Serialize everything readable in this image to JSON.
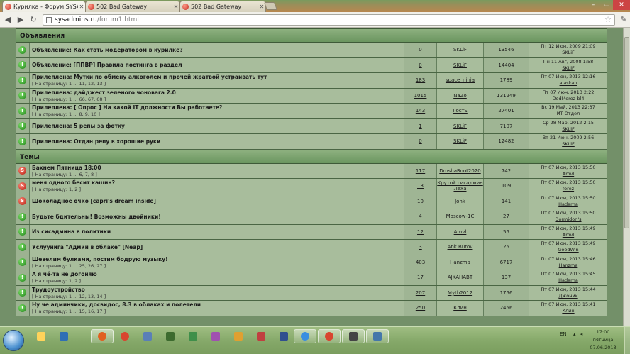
{
  "browser": {
    "tabs": [
      {
        "label": "Курилка - Форум SYSAdmins.RU",
        "active": true
      },
      {
        "label": "502 Bad Gateway",
        "active": false
      },
      {
        "label": "502 Bad Gateway",
        "active": false
      }
    ],
    "url_host": "sysadmins.ru",
    "url_path": "/forum1.html"
  },
  "sections": {
    "announcements_label": "Объявления",
    "topics_label": "Темы"
  },
  "announcements": [
    {
      "icon": "topic-ann-icon",
      "title": "Объявление: Как стать модератором в курилке?",
      "pages": "",
      "replies": "0",
      "author": "SKLiF",
      "views": "13546",
      "last_date": "Пт 12 Июн, 2009 21:09",
      "last_user": "SKLiF"
    },
    {
      "icon": "topic-ann-icon",
      "title": "Объявление: [ППВР] Правила постинга в раздел",
      "pages": "",
      "replies": "0",
      "author": "SKLiF",
      "views": "14404",
      "last_date": "Пн 11 Авг, 2008 1:58",
      "last_user": "SKLiF"
    },
    {
      "icon": "topic-ann-icon",
      "title": "Прилеплена: Мутки по обмену алкоголем и прочей жратвой устраивать тут",
      "pages": "[ На страницу: 1 ... 11, 12, 13 ]",
      "replies": "183",
      "author": "space_ninja",
      "views": "1789",
      "last_date": "Пт 07 Июн, 2013 12:16",
      "last_user": "alaskan"
    },
    {
      "icon": "topic-ann-icon",
      "title": "Прилеплена: дайджест зеленого чоновага 2.0",
      "pages": "[ На страницу: 1 ... 66, 67, 68 ]",
      "replies": "1015",
      "author": "NaZo",
      "views": "131249",
      "last_date": "Пт 07 Июн, 2013 2:22",
      "last_user": "DedMoroz-bl4"
    },
    {
      "icon": "topic-ann-icon",
      "title": "Прилеплена: [ Опрос ] На какой IT должности Вы работаете?",
      "pages": "[ На страницу: 1 ... 8, 9, 10 ]",
      "replies": "143",
      "author": "Гость",
      "views": "27401",
      "last_date": "Вс 19 Май, 2013 22:37",
      "last_user": "ИТ Отдел"
    },
    {
      "icon": "topic-ann-icon",
      "title": "Прилеплена: 5 репы за фотку",
      "pages": "",
      "replies": "1",
      "author": "SKLiF",
      "views": "7107",
      "last_date": "Ср 28 Мар, 2012 2:15",
      "last_user": "SKLiF"
    },
    {
      "icon": "topic-ann-icon",
      "title": "Прилеплена: Отдан репу в хорошие руки",
      "pages": "",
      "replies": "0",
      "author": "SKLiF",
      "views": "12482",
      "last_date": "Вт 21 Июн, 2009 2:56",
      "last_user": "SKLiF"
    }
  ],
  "topics": [
    {
      "icon": "topic-hot-icon",
      "title": "Бахнем Пятница 18:00",
      "pages": "[ На страницу: 1 ... 6, 7, 8 ]",
      "replies": "117",
      "author": "DroshaRoot2020",
      "views": "742",
      "last_date": "Пт 07 Июн, 2013 15:50",
      "last_user": "Amvl"
    },
    {
      "icon": "topic-hot-icon",
      "title": "меня одного бесит кашин?",
      "pages": "[ На страницу: 1, 2 ]",
      "replies": "13",
      "author": "Крутой сисадмин Леха",
      "views": "109",
      "last_date": "Пт 07 Июн, 2013 15:50",
      "last_user": "forez"
    },
    {
      "icon": "topic-hot-icon",
      "title": "Шоколадное очко [capri's dream inside]",
      "pages": "",
      "replies": "10",
      "author": "Jonk",
      "views": "141",
      "last_date": "Пт 07 Июн, 2013 15:50",
      "last_user": "Hadarna"
    },
    {
      "icon": "topic-norm-icon",
      "title": "Будьте бдительны! Возможны двойники!",
      "pages": "",
      "replies": "4",
      "author": "Moscow-1C",
      "views": "27",
      "last_date": "Пт 07 Июн, 2013 15:50",
      "last_user": "Dormidon's"
    },
    {
      "icon": "topic-norm-icon",
      "title": "Из сисадмина в политики",
      "pages": "",
      "replies": "12",
      "author": "Amvl",
      "views": "55",
      "last_date": "Пт 07 Июн, 2013 15:49",
      "last_user": "Amvl"
    },
    {
      "icon": "topic-norm-icon",
      "title": "Услуунига \"Админ в облаке\" [Neap]",
      "pages": "",
      "replies": "3",
      "author": "Ank Burov",
      "views": "25",
      "last_date": "Пт 07 Июн, 2013 15:49",
      "last_user": "GoodWin"
    },
    {
      "icon": "topic-norm-icon",
      "title": "Шевелим булками, постим бодрую музыку!",
      "pages": "[ На страницу: 1 ... 25, 26, 27 ]",
      "replies": "403",
      "author": "Hanzma",
      "views": "6717",
      "last_date": "Пт 07 Июн, 2013 15:46",
      "last_user": "Hanzma"
    },
    {
      "icon": "topic-norm-icon",
      "title": "А я чё-та не догоняю",
      "pages": "[ На страницу: 1, 2 ]",
      "replies": "17",
      "author": "AJKAHABT",
      "views": "137",
      "last_date": "Пт 07 Июн, 2013 15:45",
      "last_user": "Hadarna"
    },
    {
      "icon": "topic-norm-icon",
      "title": "Трудоустройство",
      "pages": "[ На страницу: 1 ... 12, 13, 14 ]",
      "replies": "207",
      "author": "Myth2012",
      "views": "1756",
      "last_date": "Пт 07 Июн, 2013 15:44",
      "last_user": "Джоник"
    },
    {
      "icon": "topic-norm-icon",
      "title": "Ну че админчики, досвидос, 8.3 в облаках и полетели",
      "pages": "[ На страницу: 1 ... 15, 16, 17 ]",
      "replies": "250",
      "author": "Клин",
      "views": "2456",
      "last_date": "Пт 07 Июн, 2013 15:41",
      "last_user": "Клин"
    }
  ],
  "taskbar": {
    "lang": "EN",
    "time": "17:00",
    "day": "пятница",
    "date": "07.06.2013"
  }
}
